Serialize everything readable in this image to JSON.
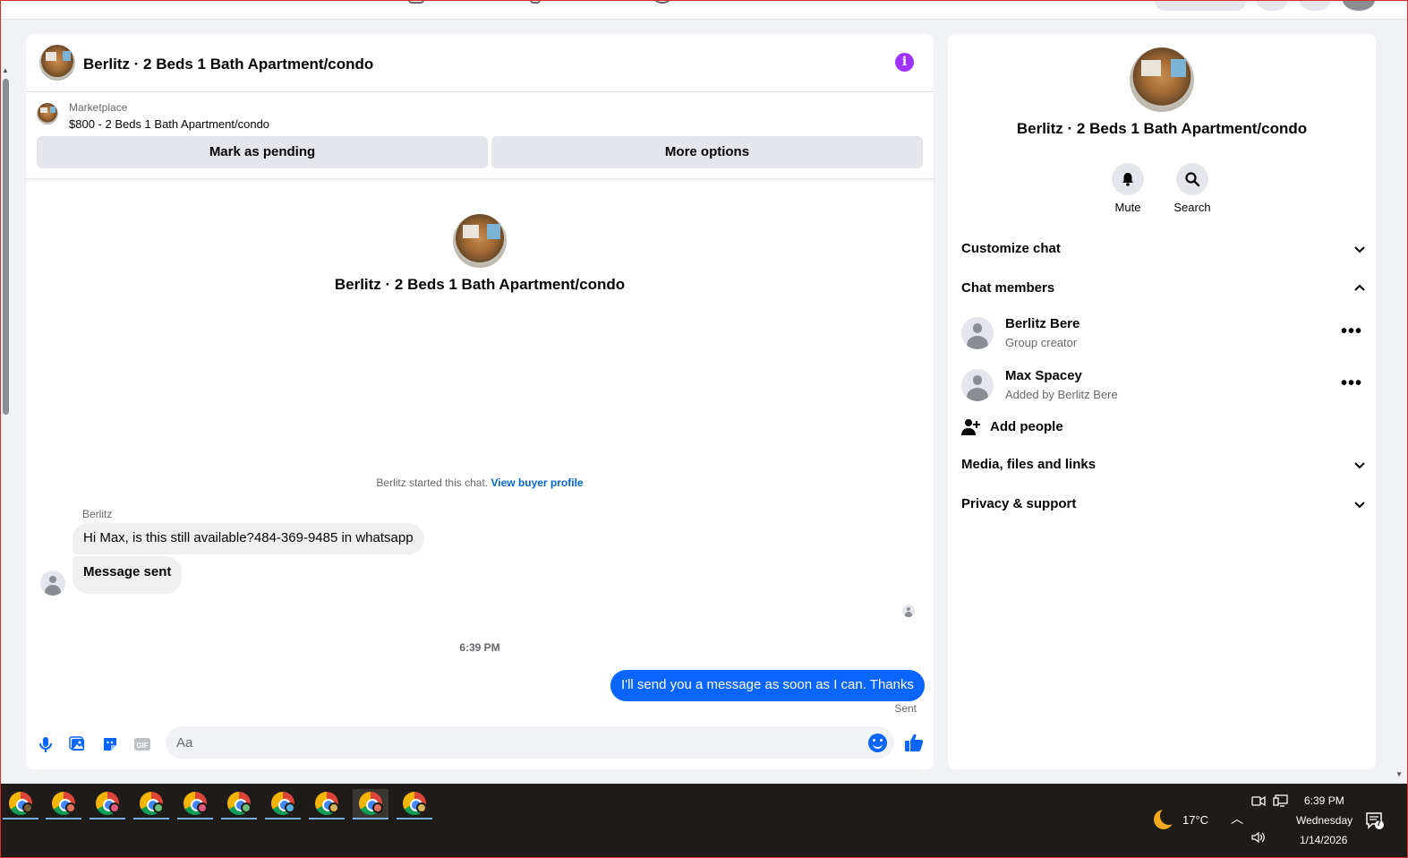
{
  "chat": {
    "title": "Berlitz · 2 Beds 1 Bath Apartment/condo",
    "marketplace_label": "Marketplace",
    "listing": "$800 - 2 Beds 1 Bath Apartment/condo",
    "mark_pending": "Mark as pending",
    "more_options": "More options",
    "started_text": "Berlitz started this chat.",
    "view_buyer_profile": "View buyer profile",
    "sender_name": "Berlitz",
    "messages": [
      {
        "text": "Hi Max, is this still available?484-369-9485 in whatsapp"
      },
      {
        "text": "Message sent"
      }
    ],
    "timestamp": "6:39 PM",
    "outgoing": "I'll send you a message as soon as I can. Thanks",
    "sent_status": "Sent",
    "composer_placeholder": "Aa"
  },
  "sidebar": {
    "title": "Berlitz · 2 Beds 1 Bath Apartment/condo",
    "mute": "Mute",
    "search": "Search",
    "customize_chat": "Customize chat",
    "chat_members": "Chat members",
    "members": [
      {
        "name": "Berlitz Bere",
        "role": "Group creator"
      },
      {
        "name": "Max Spacey",
        "role": "Added by Berlitz Bere"
      }
    ],
    "add_people": "Add people",
    "media": "Media, files and links",
    "privacy": "Privacy & support"
  },
  "taskbar": {
    "temperature": "17°C",
    "time": "6:39 PM",
    "day": "Wednesday",
    "date": "1/14/2026",
    "notification_count": "7"
  },
  "colors": {
    "accent": "#0866ff",
    "info": "#a033ff",
    "link": "#0064d1"
  }
}
